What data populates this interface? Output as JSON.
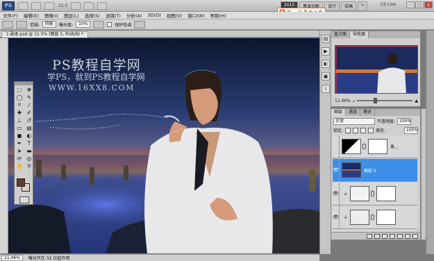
{
  "app": {
    "logo": "PS",
    "zoom_display": "11.5",
    "workspaces": [
      "2015",
      "基本功能",
      "设计",
      "绘画"
    ],
    "workspace_more": "»",
    "cs_live": "CS Live"
  },
  "ime": {
    "logo": "S",
    "items": [
      "中",
      "。",
      "☺",
      "☰",
      "✉",
      "≡",
      "⚙"
    ]
  },
  "menu": [
    "文件(F)",
    "编辑(E)",
    "图像(I)",
    "图层(L)",
    "选择(S)",
    "滤镜(T)",
    "分析(A)",
    "3D(D)",
    "视图(V)",
    "窗口(W)",
    "帮助(H)"
  ],
  "options": {
    "range_label": "范围:",
    "range_value": "阴影",
    "exposure_label": "曝光度:",
    "exposure_value": "10%",
    "protect_label": "保护色调"
  },
  "document": {
    "tab": "1 副本.psd @ 11.5% (图层 5, RGB/8) *",
    "watermark_title": "PS教程自学网",
    "watermark_sub": "学PS，就到PS教程自学网",
    "watermark_url": "WWW.16XX8.COM"
  },
  "status": {
    "zoom": "11.46%",
    "info": "曝光只在 32 位起作用"
  },
  "navigator": {
    "tabs": [
      "直方图",
      "导航器"
    ],
    "zoom": "11.46%"
  },
  "layers": {
    "tabs": [
      "图层",
      "通道",
      "路径"
    ],
    "blend_mode": "正常",
    "opacity_label": "不透明度:",
    "opacity_value": "100%",
    "lock_label": "锁定:",
    "fill_label": "填充:",
    "fill_value": "100%",
    "items": [
      {
        "name": "黑...",
        "selected": false,
        "visible": false
      },
      {
        "name": "图层 5",
        "selected": true,
        "visible": true
      },
      {
        "name": "",
        "selected": false,
        "visible": true
      },
      {
        "name": "",
        "selected": false,
        "visible": true
      },
      {
        "name": "图层 4",
        "selected": false,
        "visible": true
      },
      {
        "name": "",
        "selected": false,
        "visible": true
      }
    ]
  },
  "colors": {
    "selected_layer": "#3d8ee6",
    "fg_color": "#6a3a2e",
    "bg_color": "#e7cfc4"
  }
}
